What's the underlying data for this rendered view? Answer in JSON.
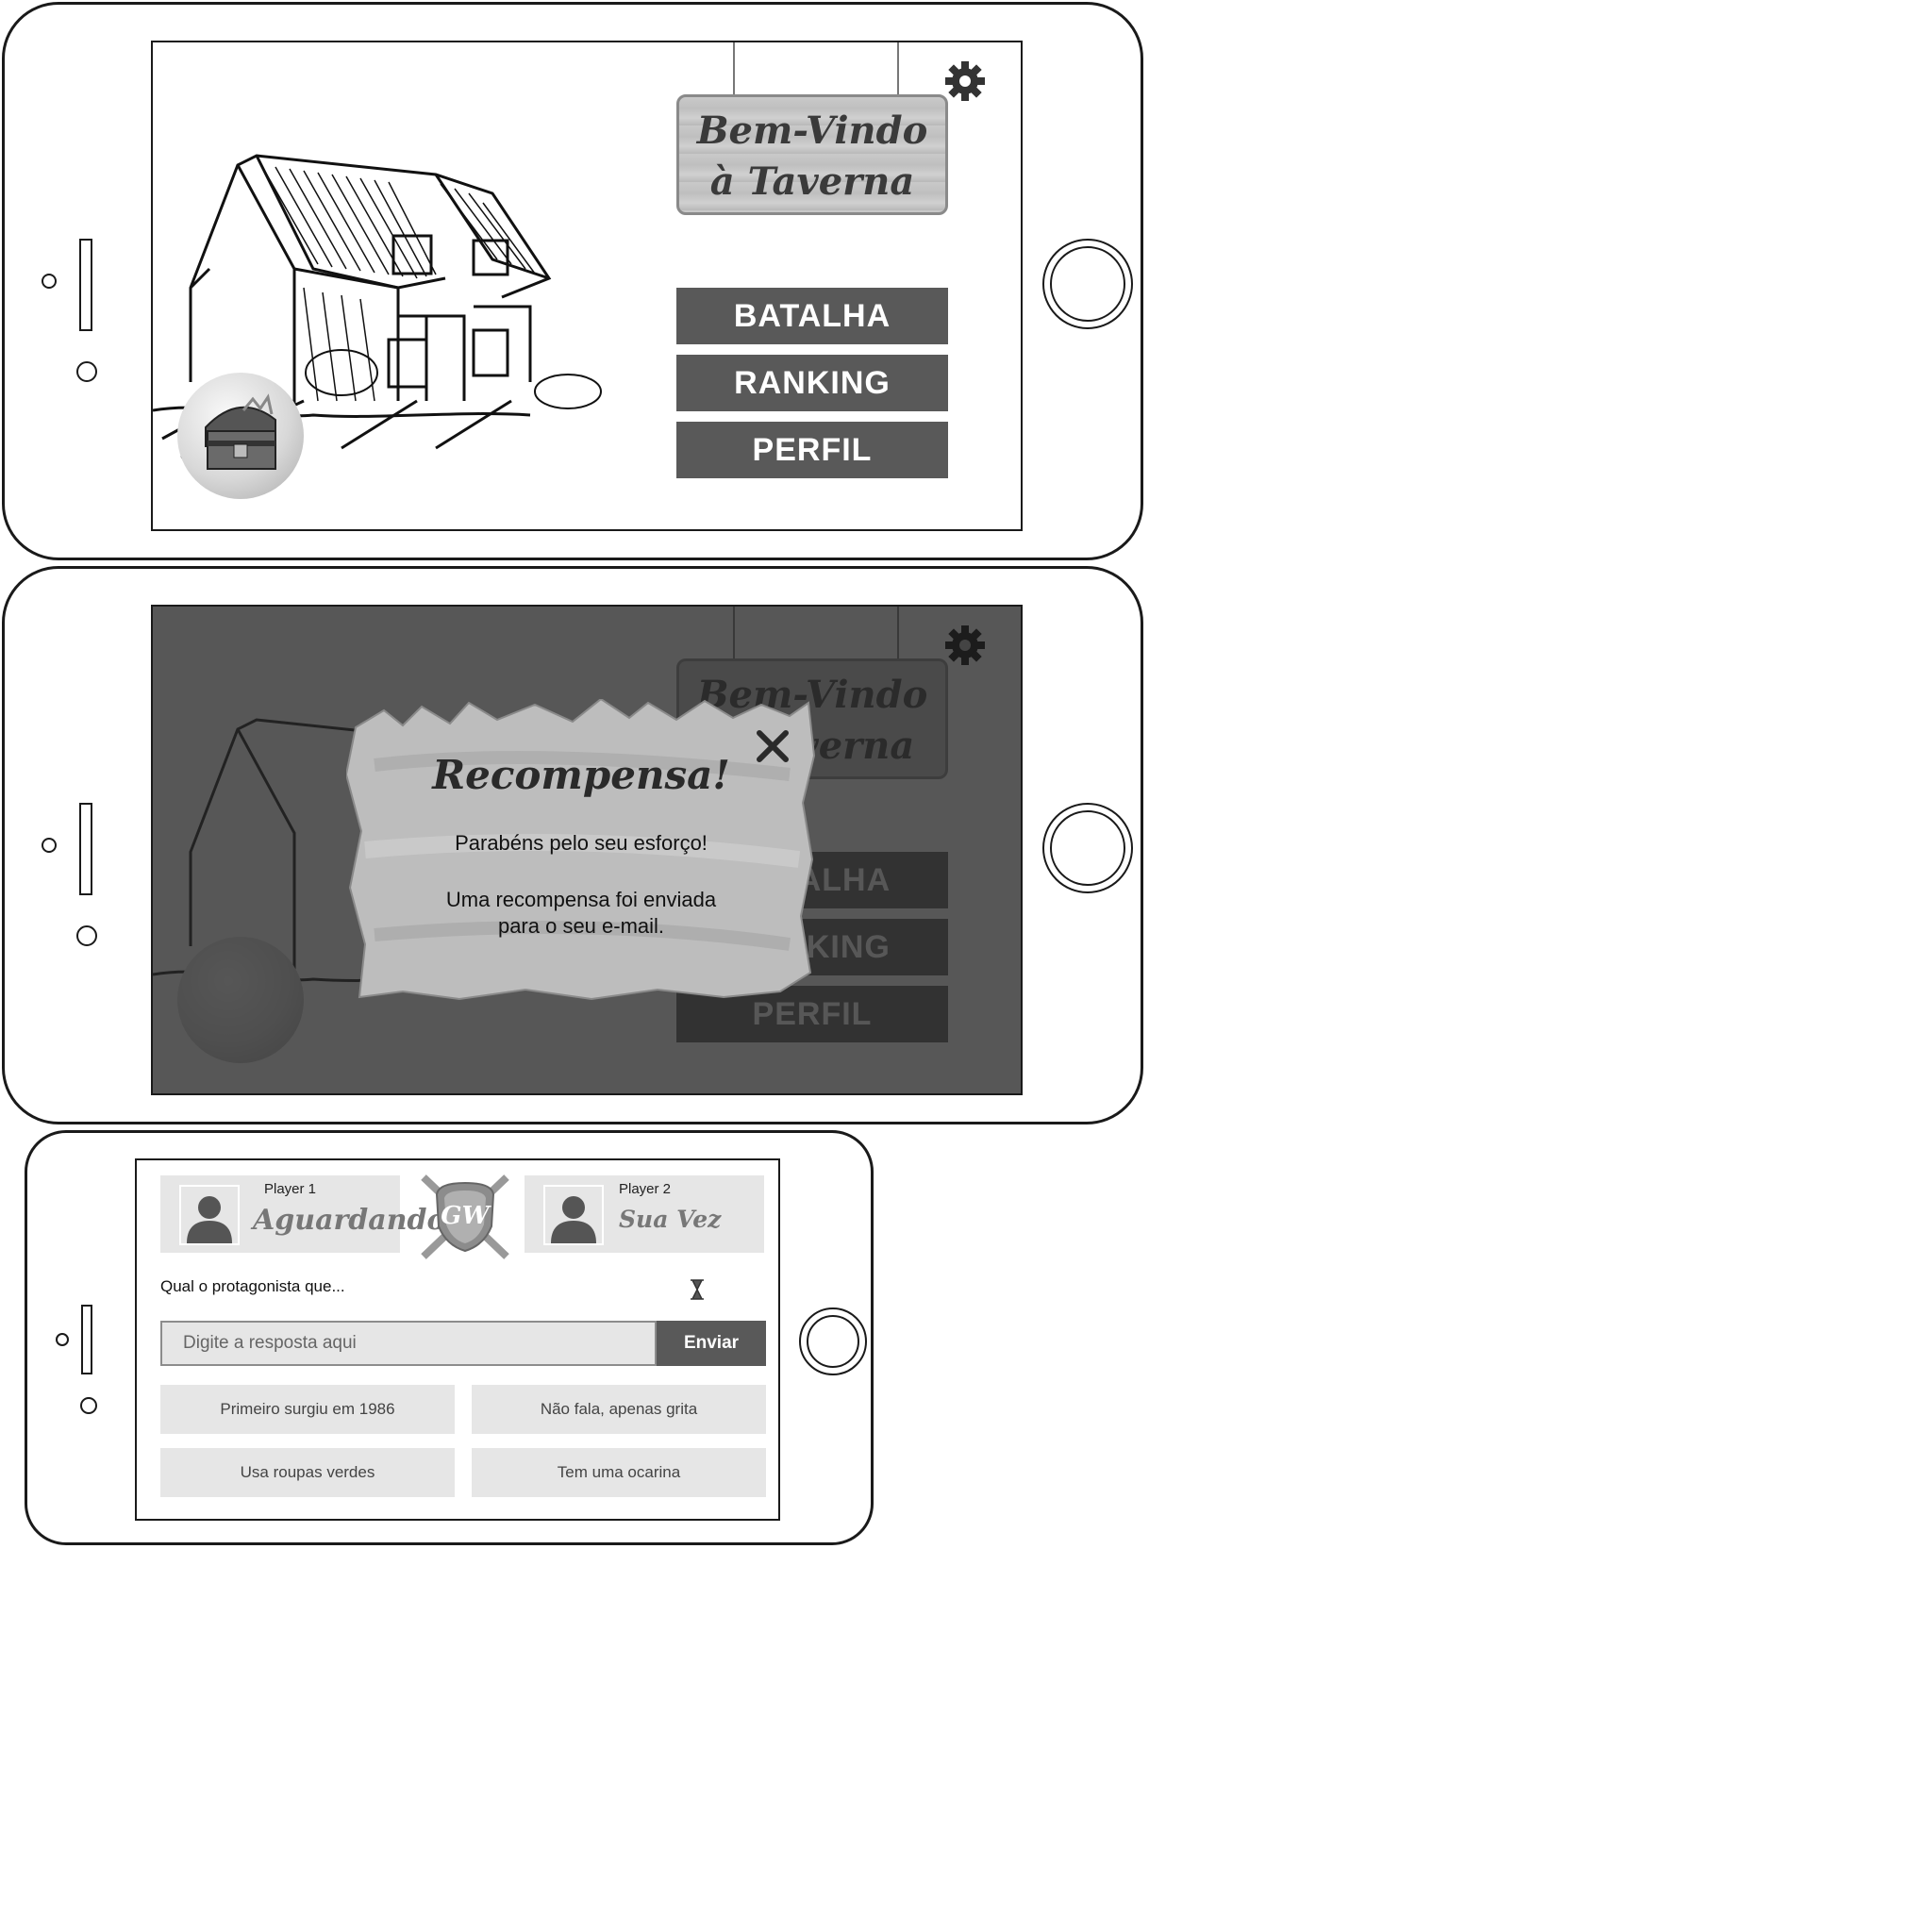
{
  "main_menu": {
    "sign_line1": "Bem-Vindo",
    "sign_line2": "à Taverna",
    "buttons": [
      "BATALHA",
      "RANKING",
      "PERFIL"
    ],
    "icons": {
      "settings": "gear-icon",
      "chest": "treasure-chest-icon",
      "house": "tavern-house-illustration"
    }
  },
  "reward_modal": {
    "title": "Recompensa!",
    "message1": "Parabéns pelo seu esforço!",
    "message2_line1": "Uma recompensa foi enviada",
    "message2_line2": "para o seu e-mail.",
    "close_icon": "close-icon"
  },
  "battle": {
    "player1": {
      "label": "Player 1",
      "status": "Aguardando"
    },
    "player2": {
      "label": "Player 2",
      "status": "Sua Vez"
    },
    "emblem": "GW",
    "question": "Qual o protagonista que...",
    "answer_placeholder": "Digite a resposta aqui",
    "send_label": "Enviar",
    "hints": [
      "Primeiro surgiu em 1986",
      "Não fala, apenas grita",
      "Usa roupas verdes",
      "Tem uma ocarina"
    ]
  },
  "colors": {
    "button_dark": "#595959",
    "panel_light": "#e6e6e6",
    "overlay": "#333333"
  }
}
